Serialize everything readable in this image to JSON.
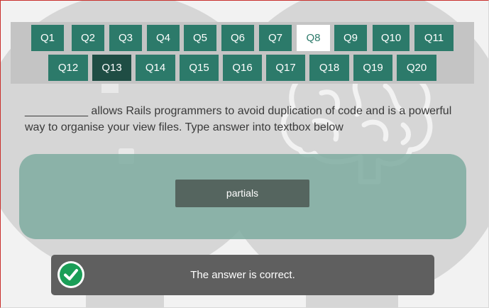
{
  "questions": [
    "Q1",
    "Q2",
    "Q3",
    "Q4",
    "Q5",
    "Q6",
    "Q7",
    "Q8",
    "Q9",
    "Q10",
    "Q11",
    "Q12",
    "Q13",
    "Q14",
    "Q15",
    "Q16",
    "Q17",
    "Q18",
    "Q19",
    "Q20"
  ],
  "current_question": "Q8",
  "visited_question": "Q13",
  "question_text": "__________ allows Rails programmers to avoid duplication of code and is a powerful way to organise your view files. Type answer into textbox below",
  "answer_value": "partials",
  "feedback_text": "The answer is correct.",
  "feedback_icon": "check-circle-icon",
  "colors": {
    "button": "#2c7a6a",
    "button_visited": "#1f4d44",
    "button_current_bg": "#ffffff",
    "panel": "#7eaba0",
    "answer_box": "#55655f",
    "feedback_bg": "#5f5f5f",
    "check": "#1a9e57"
  }
}
